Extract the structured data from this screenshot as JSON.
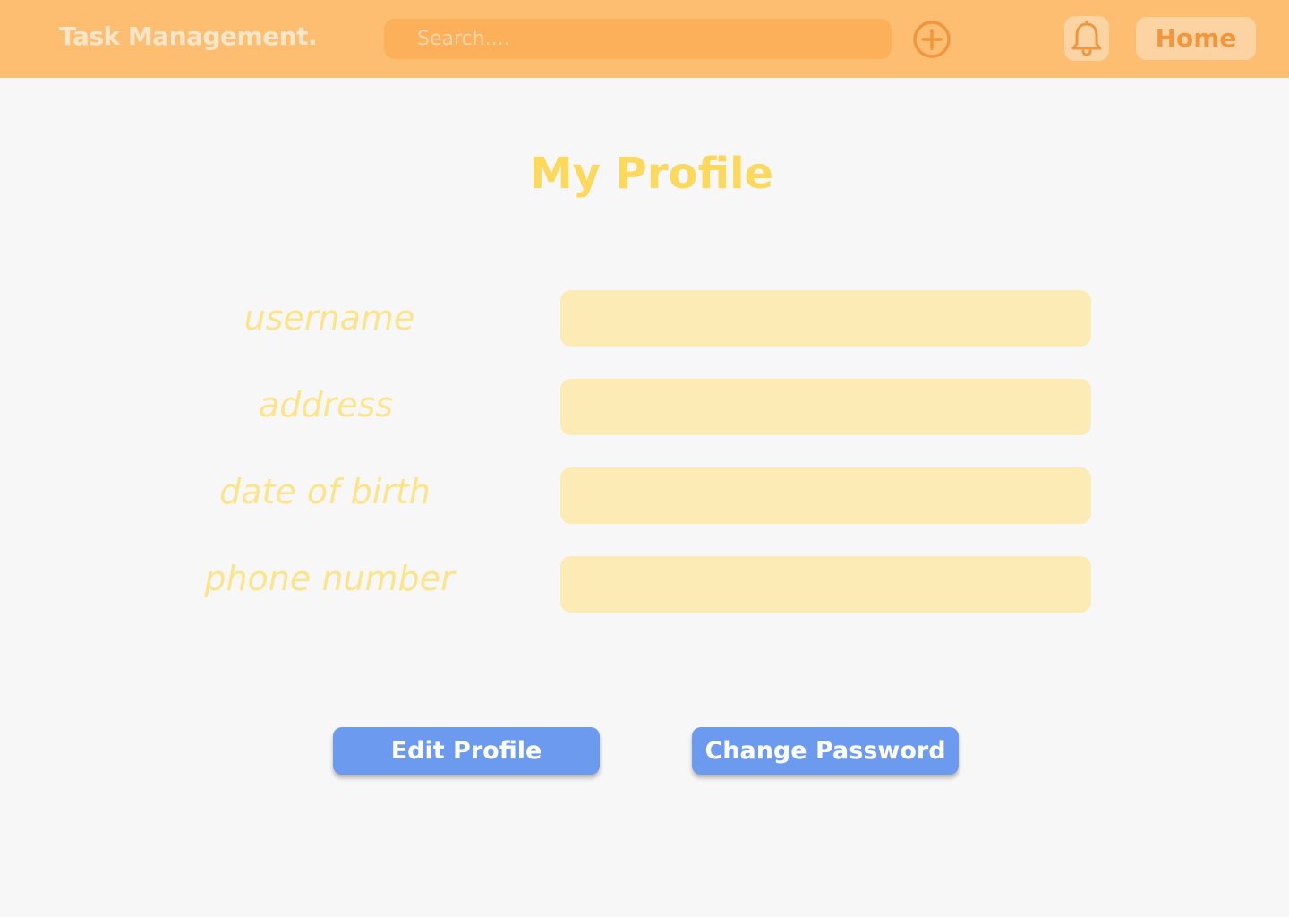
{
  "navbar": {
    "brand": "Task Management.",
    "search_placeholder": "Search....",
    "add_icon": "plus-circle-icon",
    "bell_icon": "bell-icon",
    "home_label": "Home"
  },
  "profile": {
    "title": "My Profile",
    "fields": [
      {
        "label": "username",
        "value": ""
      },
      {
        "label": "address",
        "value": ""
      },
      {
        "label": "date of birth",
        "value": ""
      },
      {
        "label": "phone number",
        "value": ""
      }
    ]
  },
  "actions": {
    "edit_label": "Edit Profile",
    "change_password_label": "Change Password"
  },
  "colors": {
    "navbar_bg": "#fdbe72",
    "accent_orange": "#f2963e",
    "title_yellow": "#fcd95c",
    "field_bg": "#fcebb4",
    "button_blue": "#6b9aef"
  }
}
